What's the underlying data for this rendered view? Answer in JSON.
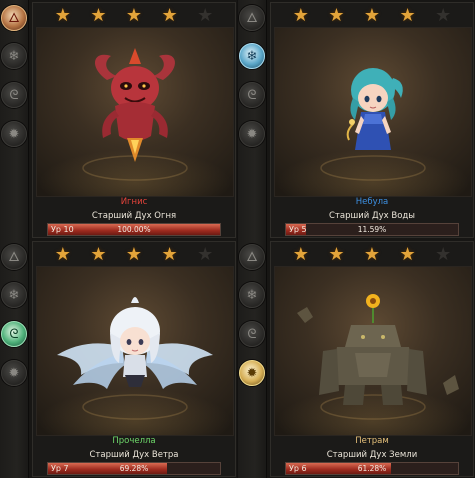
{
  "spirits": [
    {
      "name": "Игнис",
      "name_color": "#e3433a",
      "title": "Старший Дух Огня",
      "level_label": "Ур 10",
      "progress_text": "100.00%",
      "progress": 1.0,
      "stars_filled": 4,
      "stars_total": 5,
      "active_element": "fire",
      "elements": [
        "fire-icon",
        "snowflake-icon",
        "wind-icon",
        "earth-icon"
      ]
    },
    {
      "name": "Небула",
      "name_color": "#3d8fe0",
      "title": "Старший Дух Воды",
      "level_label": "Ур 5",
      "progress_text": "11.59%",
      "progress": 0.1159,
      "stars_filled": 4,
      "stars_total": 5,
      "active_element": "water",
      "elements": [
        "fire-icon",
        "snowflake-icon",
        "wind-icon",
        "earth-icon"
      ]
    },
    {
      "name": "Прочелла",
      "name_color": "#6ed86a",
      "title": "Старший Дух Ветра",
      "level_label": "Ур 7",
      "progress_text": "69.28%",
      "progress": 0.6928,
      "stars_filled": 4,
      "stars_total": 5,
      "active_element": "wind",
      "elements": [
        "fire-icon",
        "snowflake-icon",
        "wind-icon",
        "earth-icon"
      ]
    },
    {
      "name": "Петрам",
      "name_color": "#e5c07a",
      "title": "Старший Дух Земли",
      "level_label": "Ур 6",
      "progress_text": "61.28%",
      "progress": 0.6128,
      "stars_filled": 4,
      "stars_total": 5,
      "active_element": "earth",
      "elements": [
        "fire-icon",
        "snowflake-icon",
        "wind-icon",
        "earth-icon"
      ]
    }
  ]
}
